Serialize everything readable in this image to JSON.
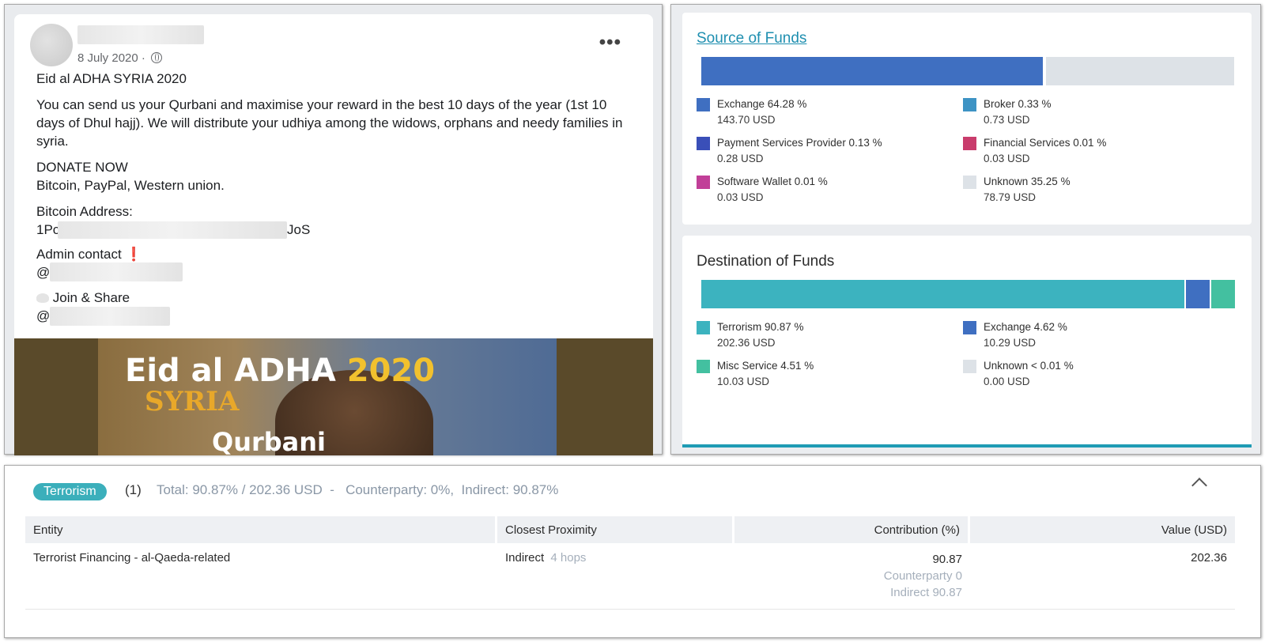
{
  "post": {
    "date": "8 July 2020 ·",
    "title": "Eid al ADHA SYRIA 2020",
    "body": "You can send us your Qurbani and maximise your reward in the best 10 days of the year (1st 10 days of Dhul hajj). We will distribute your udhiya among the widows, orphans and needy families in syria.",
    "donate_heading": "DONATE NOW",
    "donate_methods": "Bitcoin, PayPal, Western union.",
    "bitcoin_label": "Bitcoin Address:",
    "bitcoin_prefix": "1Pc",
    "bitcoin_suffix": "JoS",
    "admin_label": "Admin contact",
    "admin_mark": "❗",
    "at_symbol": "@",
    "join_label": "Join & Share",
    "image_line1": "Eid al ADHA ",
    "image_year": "2020",
    "image_line2": "SYRIA",
    "image_line3": "Qurbani"
  },
  "source": {
    "title": "Source of Funds",
    "bar": [
      {
        "color": "#3f6fc1",
        "fraction": 0.6428
      },
      {
        "color": "#c8d2dc",
        "fraction": 0.0033
      },
      {
        "color": "#dde2e7",
        "fraction": 0.3525
      }
    ],
    "legend": [
      {
        "label": "Exchange 64.28 %",
        "value": "143.70 USD",
        "color": "#3f6fc1"
      },
      {
        "label": "Broker 0.33 %",
        "value": "0.73 USD",
        "color": "#3d93c4"
      },
      {
        "label": "Payment Services Provider 0.13 %",
        "value": "0.28 USD",
        "color": "#3a4fb8"
      },
      {
        "label": "Financial Services 0.01 %",
        "value": "0.03 USD",
        "color": "#c93c6c"
      },
      {
        "label": "Software Wallet 0.01 %",
        "value": "0.03 USD",
        "color": "#c13f98"
      },
      {
        "label": "Unknown 35.25 %",
        "value": "78.79 USD",
        "color": "#dde2e7"
      }
    ]
  },
  "destination": {
    "title": "Destination of Funds",
    "bar": [
      {
        "color": "#3cb3bf",
        "fraction": 0.9087
      },
      {
        "color": "#3f6fc1",
        "fraction": 0.0462
      },
      {
        "color": "#43c0a0",
        "fraction": 0.0451
      }
    ],
    "legend": [
      {
        "label": "Terrorism 90.87 %",
        "value": "202.36 USD",
        "color": "#3cb3bf"
      },
      {
        "label": "Exchange 4.62 %",
        "value": "10.29 USD",
        "color": "#3f6fc1"
      },
      {
        "label": "Misc Service 4.51 %",
        "value": "10.03 USD",
        "color": "#43c0a0"
      },
      {
        "label": "Unknown < 0.01 %",
        "value": "0.00 USD",
        "color": "#dde2e7"
      }
    ]
  },
  "category": {
    "badge": "Terrorism",
    "count": "(1)",
    "summary": "Total: 90.87% / 202.36 USD  -   Counterparty: 0%,  Indirect: 90.87%",
    "columns": [
      "Entity",
      "Closest Proximity",
      "Contribution (%)",
      "Value (USD)"
    ],
    "rows": [
      {
        "entity": "Terrorist Financing - al-Qaeda-related",
        "proximity": "Indirect",
        "hops": "4 hops",
        "contribution": "90.87",
        "counterparty": "Counterparty 0",
        "indirect": "Indirect 90.87",
        "value": "202.36"
      }
    ]
  }
}
